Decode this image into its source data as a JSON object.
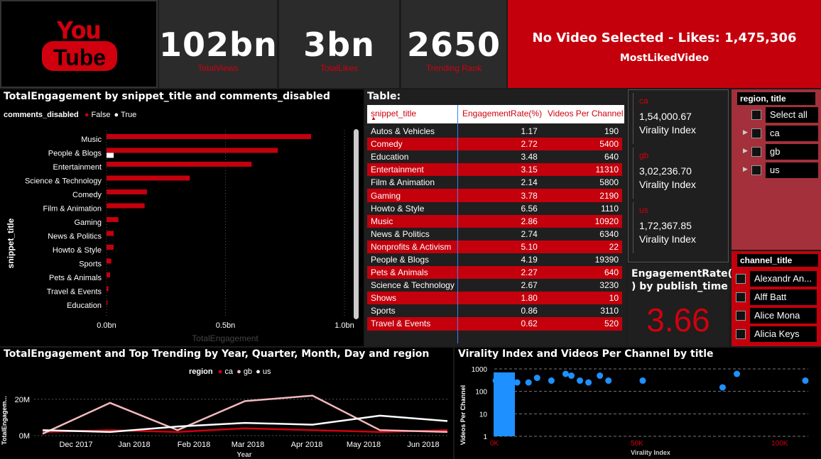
{
  "logo": {
    "line1": "You",
    "line2": "Tube"
  },
  "kpis": [
    {
      "value": "102bn",
      "label": "TotalViews"
    },
    {
      "value": "3bn",
      "label": "TotalLikes"
    },
    {
      "value": "2650",
      "label": "Trending Rank"
    }
  ],
  "most_liked": {
    "headline": "No Video Selected - Likes: 1,475,306",
    "label": "MostLikedVideo"
  },
  "bar_chart": {
    "title": "TotalEngagement by snippet_title and comments_disabled",
    "legend_title": "comments_disabled",
    "legend": [
      "False",
      "True"
    ],
    "ylabel": "snippet_title",
    "xlabel": "TotalEngagement",
    "ticks": [
      "0.0bn",
      "0.5bn",
      "1.0bn"
    ]
  },
  "chart_data": [
    {
      "type": "bar",
      "title": "TotalEngagement by snippet_title and comments_disabled",
      "xlabel": "TotalEngagement",
      "ylabel": "snippet_title",
      "categories": [
        "Music",
        "People & Blogs",
        "Entertainment",
        "Science & Technology",
        "Comedy",
        "Film & Animation",
        "Gaming",
        "News & Politics",
        "Howto & Style",
        "Sports",
        "Pets & Animals",
        "Travel & Events",
        "Education"
      ],
      "series": [
        {
          "name": "False",
          "values": [
            0.86,
            0.72,
            0.61,
            0.35,
            0.17,
            0.16,
            0.05,
            0.03,
            0.03,
            0.02,
            0.015,
            0.008,
            0.004
          ]
        },
        {
          "name": "True",
          "values": [
            0,
            0.03,
            0,
            0,
            0,
            0,
            0,
            0,
            0,
            0,
            0,
            0,
            0
          ]
        }
      ],
      "units": "bn",
      "xlim": [
        0,
        1.0
      ],
      "colors": {
        "False": "#c4000d",
        "True": "#ffffff"
      }
    },
    {
      "type": "line",
      "title": "TotalEngagement and Top Trending by Year, Quarter, Month, Day and region",
      "xlabel": "Year",
      "ylabel": "TotalEngagem...",
      "x": [
        "Dec 2017",
        "Jan 2018",
        "Feb 2018",
        "Mar 2018",
        "Apr 2018",
        "May 2018",
        "Jun 2018"
      ],
      "ylim": [
        0,
        25
      ],
      "yunits": "M",
      "series": [
        {
          "name": "ca",
          "values": [
            2,
            3,
            2,
            4,
            3,
            2,
            3
          ]
        },
        {
          "name": "gb",
          "values": [
            1,
            18,
            3,
            19,
            22,
            3,
            2
          ]
        },
        {
          "name": "us",
          "values": [
            3,
            2,
            5,
            7,
            6,
            11,
            8
          ]
        }
      ],
      "colors": {
        "ca": "#d1000e",
        "gb": "#f2b8bd",
        "us": "#ffffff"
      }
    },
    {
      "type": "scatter",
      "title": "Virality Index and Videos Per Channel by title",
      "xlabel": "Virality Index",
      "ylabel": "Videos Per Channel",
      "xlim": [
        0,
        110000
      ],
      "ylim": [
        1,
        1000
      ],
      "yscale": "log",
      "points": [
        [
          500,
          300
        ],
        [
          1000,
          250
        ],
        [
          2000,
          400
        ],
        [
          4000,
          300
        ],
        [
          6000,
          200
        ],
        [
          8000,
          250
        ],
        [
          12000,
          250
        ],
        [
          15000,
          400
        ],
        [
          20000,
          300
        ],
        [
          25000,
          600
        ],
        [
          27000,
          500
        ],
        [
          30000,
          300
        ],
        [
          33000,
          250
        ],
        [
          37000,
          500
        ],
        [
          40000,
          300
        ],
        [
          52000,
          300
        ],
        [
          80000,
          150
        ],
        [
          85000,
          600
        ],
        [
          109000,
          300
        ]
      ],
      "color": "#1e90ff"
    }
  ],
  "table": {
    "title": "Table:",
    "headers": [
      "snippet_title",
      "EngagementRate(%)",
      "Videos Per Channel"
    ],
    "rows": [
      [
        "Autos & Vehicles",
        "1.17",
        "190"
      ],
      [
        "Comedy",
        "2.72",
        "5400"
      ],
      [
        "Education",
        "3.48",
        "640"
      ],
      [
        "Entertainment",
        "3.15",
        "11310"
      ],
      [
        "Film & Animation",
        "2.14",
        "5800"
      ],
      [
        "Gaming",
        "3.78",
        "2190"
      ],
      [
        "Howto & Style",
        "6.56",
        "1110"
      ],
      [
        "Music",
        "2.86",
        "10920"
      ],
      [
        "News & Politics",
        "2.74",
        "6340"
      ],
      [
        "Nonprofits & Activism",
        "5.10",
        "22"
      ],
      [
        "People & Blogs",
        "4.19",
        "19390"
      ],
      [
        "Pets & Animals",
        "2.27",
        "640"
      ],
      [
        "Science & Technology",
        "2.67",
        "3230"
      ],
      [
        "Shows",
        "1.80",
        "10"
      ],
      [
        "Sports",
        "0.86",
        "3110"
      ],
      [
        "Travel & Events",
        "0.62",
        "520"
      ]
    ]
  },
  "virality_cards": [
    {
      "region": "ca",
      "value": "1,54,000.67",
      "label": "Virality Index"
    },
    {
      "region": "gb",
      "value": "3,02,236.70",
      "label": "Virality Index"
    },
    {
      "region": "us",
      "value": "1,72,367.85",
      "label": "Virality Index"
    }
  ],
  "engagement_card": {
    "title_line1": "EngagementRate(%",
    "title_line2": ") by publish_time",
    "value": "3.66"
  },
  "region_slicer": {
    "title": "region, title",
    "items": [
      "Select all",
      "ca",
      "gb",
      "us"
    ]
  },
  "channel_slicer": {
    "title": "channel_title",
    "items": [
      "Alexandr An...",
      "Alff Batt",
      "Alice Mona",
      "Alicia Keys"
    ]
  },
  "line_chart": {
    "title": "TotalEngagement and Top Trending by Year, Quarter, Month, Day and region",
    "legend_title": "region",
    "legend": [
      "ca",
      "gb",
      "us"
    ],
    "ylabel": "TotalEngagem...",
    "xlabel": "Year",
    "yticks": [
      "20M",
      "0M"
    ],
    "xticks": [
      "Dec 2017",
      "Jan 2018",
      "Feb 2018",
      "Mar 2018",
      "Apr 2018",
      "May 2018",
      "Jun 2018"
    ]
  },
  "scatter_chart": {
    "title": "Virality Index and Videos Per Channel by title",
    "ylabel": "Videos Per Channel",
    "xlabel": "Virality Index",
    "yticks": [
      "1000",
      "100",
      "10",
      "1"
    ],
    "xticks": [
      "0K",
      "50K",
      "100K"
    ]
  }
}
